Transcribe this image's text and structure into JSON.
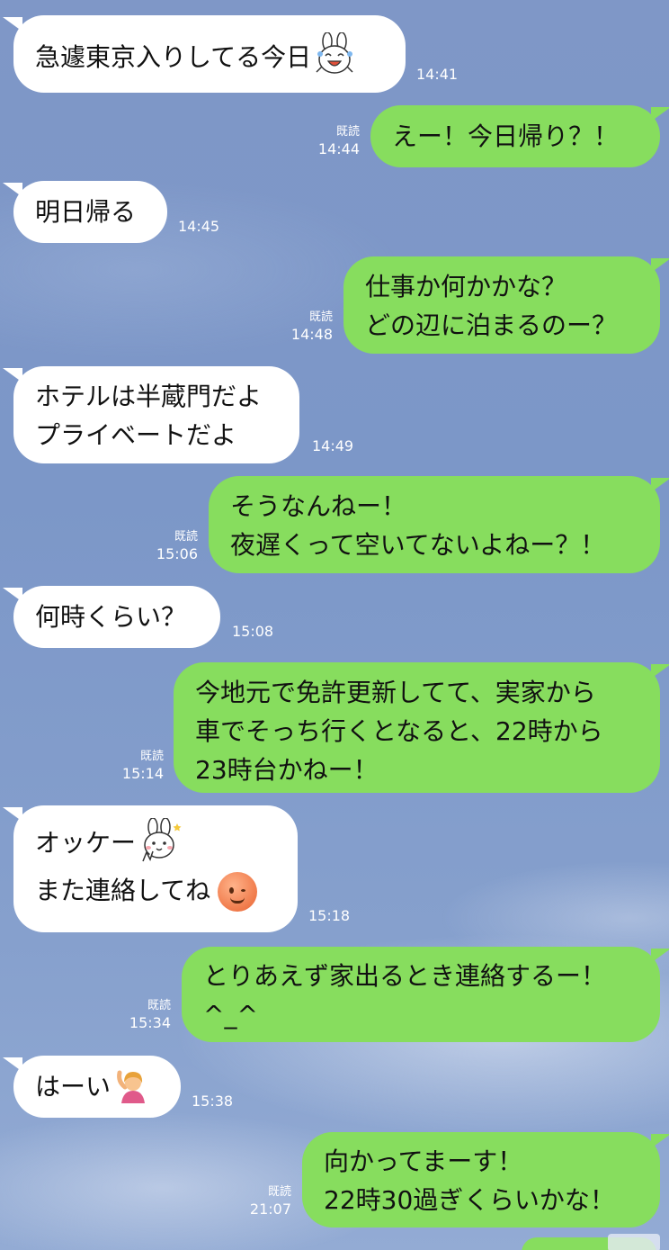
{
  "messages": [
    {
      "side": "left",
      "lines": [
        "急遽東京入りしてる今日"
      ],
      "time": "14:41",
      "emoji": "bunny-laugh-icon"
    },
    {
      "side": "right",
      "lines": [
        "えー！今日帰り？！"
      ],
      "time": "14:44",
      "read": "既読"
    },
    {
      "side": "left",
      "lines": [
        "明日帰る"
      ],
      "time": "14:45"
    },
    {
      "side": "right",
      "lines": [
        "仕事か何かかな？",
        "どの辺に泊まるのー？"
      ],
      "time": "14:48",
      "read": "既読"
    },
    {
      "side": "left",
      "lines": [
        "ホテルは半蔵門だよ",
        "プライベートだよ"
      ],
      "time": "14:49"
    },
    {
      "side": "right",
      "lines": [
        "そうなんねー！",
        "夜遅くって空いてないよねー？！"
      ],
      "time": "15:06",
      "read": "既読"
    },
    {
      "side": "left",
      "lines": [
        "何時くらい？"
      ],
      "time": "15:08"
    },
    {
      "side": "right",
      "lines": [
        "今地元で免許更新してて、実家から",
        "車でそっち行くとなると、22時から",
        "23時台かねー！"
      ],
      "time": "15:14",
      "read": "既読"
    },
    {
      "side": "left",
      "lines": [
        "オッケー",
        "また連絡してね"
      ],
      "time": "15:18",
      "emoji": [
        "bunny-peace-icon",
        "wink-face-icon"
      ]
    },
    {
      "side": "right",
      "lines": [
        "とりあえず家出るとき連絡するー！",
        "^_^"
      ],
      "time": "15:34",
      "read": "既読"
    },
    {
      "side": "left",
      "lines": [
        "はーい"
      ],
      "time": "15:38",
      "emoji": "person-raising-hand-icon"
    },
    {
      "side": "right",
      "lines": [
        "向かってまーす！",
        "22時30過ぎくらいかな！"
      ],
      "time": "21:07",
      "read": "既読"
    }
  ],
  "colors": {
    "sent_bubble": "#87dd5e",
    "received_bubble": "#ffffff",
    "meta_text": "#ffffff"
  }
}
